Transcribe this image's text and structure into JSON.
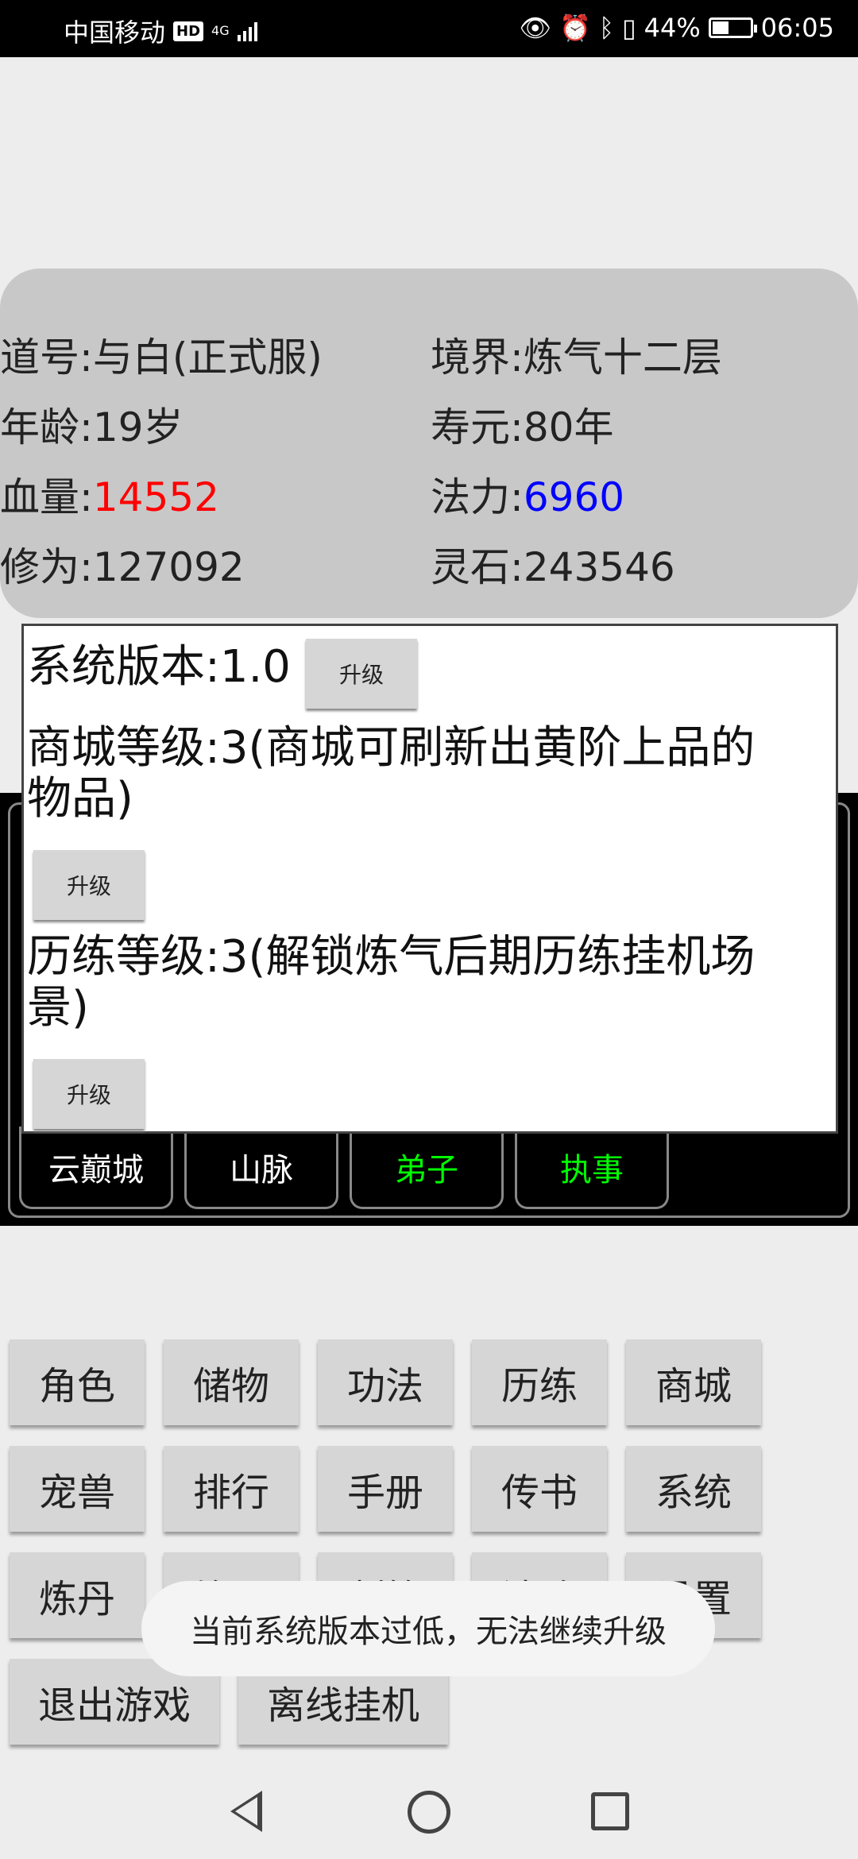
{
  "status_bar": {
    "carrier": "中国移动",
    "hd": "HD",
    "network": "4G",
    "battery": "44%",
    "battery_level": 0.44,
    "time": "06:05"
  },
  "info": {
    "daohao": "道号:与白(正式服)",
    "jingjie": "境界:炼气十二层",
    "age": "年龄:19岁",
    "shouyuan": "寿元:80年",
    "hp_label": "血量:",
    "hp_value": "14552",
    "mp_label": "法力:",
    "mp_value": "6960",
    "xiuwei": "修为:127092",
    "lingshi": "灵石:243546"
  },
  "dialog": {
    "system_version": "系统版本:1.0",
    "shop_level_line1": "商城等级:3(商城可刷新出黄阶上品的",
    "shop_level_line2": "物品)",
    "train_level_line1": "历练等级:3(解锁炼气后期历练挂机场",
    "train_level_line2": "景)",
    "upgrade_label": "升级"
  },
  "map_tabs": [
    "云巅城",
    "山脉",
    "弟子",
    "执事"
  ],
  "map_tab_green_color": "#00ff00",
  "grid": {
    "row1": [
      "角色",
      "储物",
      "功法",
      "历练",
      "商城"
    ],
    "row2": [
      "宠兽",
      "排行",
      "手册",
      "传书",
      "系统"
    ],
    "row3": [
      "炼丹",
      "炼器",
      "制符",
      "法阵",
      "设置"
    ],
    "row4": [
      "退出游戏",
      "离线挂机"
    ]
  },
  "toast": "当前系统版本过低，无法继续升级",
  "colors": {
    "hp": "#ff0000",
    "mp": "#0000ff"
  }
}
